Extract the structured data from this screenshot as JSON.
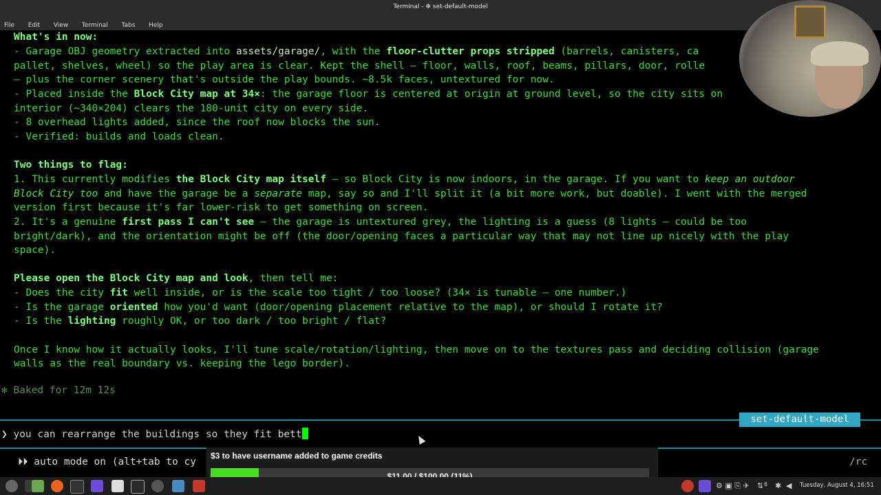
{
  "window": {
    "title": "Terminal - ✻ set-default-model"
  },
  "menu": [
    "File",
    "Edit",
    "View",
    "Terminal",
    "Tabs",
    "Help"
  ],
  "output": {
    "heading_now": "What's in now:",
    "l1a": "- Garage OBJ geometry extracted into ",
    "l1b": "assets/garage/",
    "l1c": ", with the ",
    "l1d": "floor-clutter props stripped",
    "l1e": " (barrels, canisters, ca",
    "l2": "pallet, shelves, wheel) so the play area is clear. Kept the shell — floor, walls, roof, beams, pillars, door, rolle",
    "l3": "— plus the corner scenery that's outside the play bounds. ~8.5k faces, untextured for now.",
    "l4a": "- Placed inside the ",
    "l4b": "Block City map at 34×",
    "l4c": ": the garage floor is centered at origin at ground level, so the city sits on",
    "l5": "interior (~340×204) clears the 180-unit city on every side.",
    "l6": "- 8 overhead lights added, since the roof now blocks the sun.",
    "l7": "- Verified: builds and loads clean.",
    "heading_flag": "Two things to flag:",
    "f1a": "1. This currently modifies ",
    "f1b": "the Block City map itself",
    "f1c": " — so Block City is now indoors, in the garage. If you want to ",
    "f1d": "keep an outdoor",
    "f2a": "Block City too",
    "f2b": " and have the garage be a ",
    "f2c": "separate",
    "f2d": " map, say so and I'll split it (a bit more work, but doable). I went with the merged",
    "f3": "version first because it's far lower-risk to get something on screen.",
    "f4a": "2. It's a genuine ",
    "f4b": "first pass I can't see",
    "f4c": " — the garage is untextured grey, the lighting is a guess (8 lights — could be too",
    "f5": "bright/dark), and the orientation might be off (the door/opening faces a particular way that may not line up nicely with the play",
    "f6": "space).",
    "p1a": "Please open the Block City map and look",
    "p1b": ", then tell me:",
    "q1a": "- Does the city ",
    "q1b": "fit",
    "q1c": " well inside, or is the scale too tight / too loose? (34× is tunable — one number.)",
    "q2a": "- Is the garage ",
    "q2b": "oriented",
    "q2c": " how you'd want (door/opening placement relative to the map), or should I rotate it?",
    "q3a": "- Is the ",
    "q3b": "lighting",
    "q3c": " roughly OK, or too dark / too bright / flat?",
    "o1": "Once I know how it actually looks, I'll tune scale/rotation/lighting, then move on to the textures pass and deciding collision (garage",
    "o2": "walls as the real boundary vs. keeping the lego border).",
    "baked": "✻ Baked for 12m 12s"
  },
  "model_badge": "set-default-model",
  "prompt": {
    "symbol": "❯",
    "text": " you can rearrange the buildings so they fit bett"
  },
  "auto_mode": "⏵⏵ auto mode on (alt+tab to cy",
  "rc": "/rc",
  "donation": {
    "label": "$3 to have username added to game credits",
    "progress_text": "$11.00 / $100.00 (11%)",
    "progress_fraction": 0.11
  },
  "tray": {
    "network_count": "6",
    "clock": "Tuesday, August  4, 16:51"
  },
  "colors": {
    "accent": "#1e8c9e",
    "badge": "#30a8c4",
    "progress": "#44dd22",
    "text_green": "#3cdc3c"
  }
}
